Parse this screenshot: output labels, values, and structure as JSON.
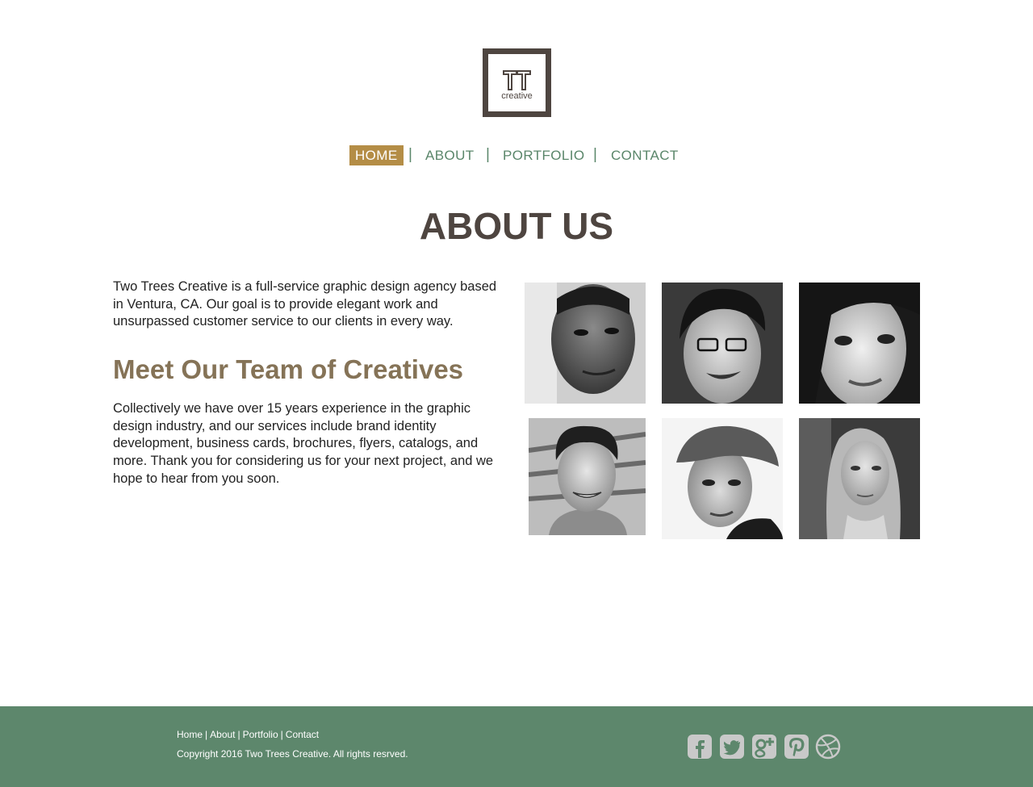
{
  "logo": {
    "word": "creative"
  },
  "nav": {
    "items": [
      {
        "label": "HOME",
        "active": true
      },
      {
        "label": "ABOUT",
        "active": false
      },
      {
        "label": "PORTFOLIO",
        "active": false
      },
      {
        "label": "CONTACT",
        "active": false
      }
    ],
    "separator": "|"
  },
  "page": {
    "title": "ABOUT US",
    "intro": "Two Trees Creative is a full-service graphic design agency based in Ventura, CA. Our goal is to provide elegant work and unsurpassed customer service to our clients in every way.",
    "team_heading": "Meet Our Team of Creatives",
    "team_text": "Collectively we have over 15 years experience in the graphic design industry, and our services include brand identity development, business cards, brochures, flyers, catalogs, and more. Thank you for considering us for your next project, and we hope to hear from you soon."
  },
  "team_photos": [
    {
      "icon": "team-member-photo-1"
    },
    {
      "icon": "team-member-photo-2"
    },
    {
      "icon": "team-member-photo-3"
    },
    {
      "icon": "team-member-photo-4"
    },
    {
      "icon": "team-member-photo-5"
    },
    {
      "icon": "team-member-photo-6"
    }
  ],
  "footer": {
    "links": [
      "Home",
      "About",
      "Portfolio",
      "Contact"
    ],
    "separator": "|",
    "copyright": "Copyright 2016 Two Trees Creative. All rights resrved.",
    "social_icons": [
      "facebook-icon",
      "twitter-icon",
      "google-plus-icon",
      "pinterest-icon",
      "dribbble-icon"
    ]
  },
  "colors": {
    "brand_dark": "#4e4540",
    "accent_gold": "#b48d46",
    "nav_green": "#5a866a",
    "footer_green": "#5d876c",
    "subheading_tan": "#857357"
  }
}
